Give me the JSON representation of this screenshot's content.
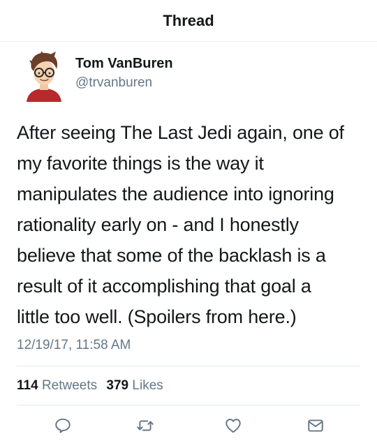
{
  "nav": {
    "title": "Thread"
  },
  "tweet": {
    "author_name": "Tom VanBuren",
    "author_handle": "@trvanburen",
    "text_lines": [
      "After seeing The Last Jedi again, one of",
      "my favorite things is the way it",
      "manipulates the audience into ignoring",
      "rationality early on - and I honestly",
      "believe that some of the backlash is a",
      "result of it accomplishing that goal a",
      "little too well. (Spoilers from here.)"
    ],
    "timestamp": "12/19/17, 11:58 AM"
  },
  "stats": {
    "retweets_count": "114",
    "retweets_label": "Retweets",
    "likes_count": "379",
    "likes_label": "Likes"
  },
  "actions": {
    "reply_icon": "reply-icon",
    "retweet_icon": "retweet-icon",
    "like_icon": "heart-icon",
    "dm_icon": "envelope-icon"
  },
  "colors": {
    "text_primary": "#14171a",
    "text_secondary": "#657786",
    "divider": "#e1e8ed"
  }
}
